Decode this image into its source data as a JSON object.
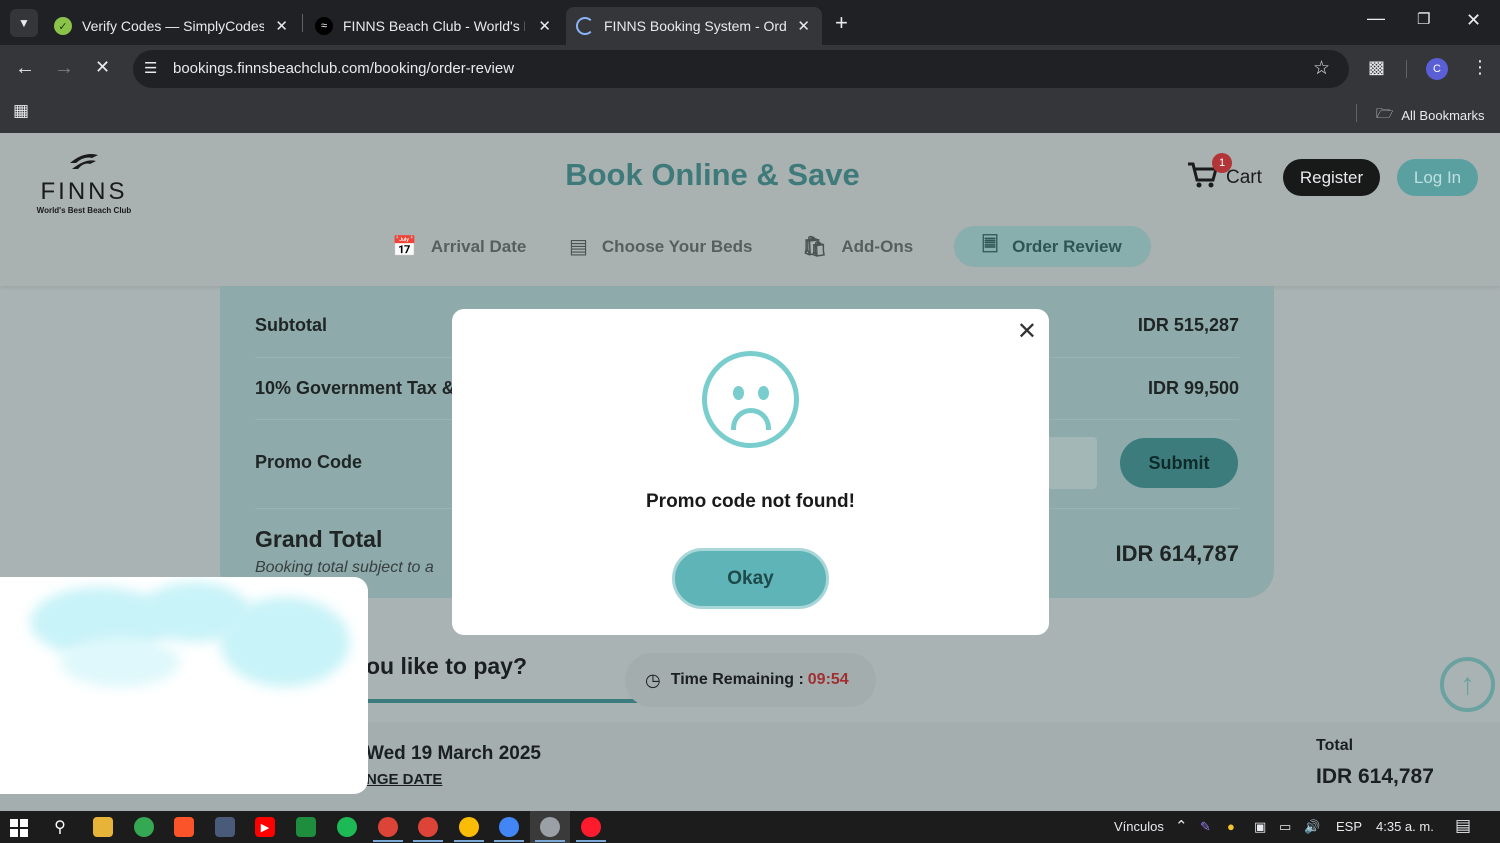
{
  "browser": {
    "tabs": [
      {
        "title": "Verify Codes — SimplyCodes",
        "active": false
      },
      {
        "title": "FINNS Beach Club - World's Best",
        "active": false
      },
      {
        "title": "FINNS Booking System - Order",
        "active": true
      }
    ],
    "url": "bookings.finnsbeachclub.com/booking/order-review",
    "profile_initial": "C",
    "bookmarks_label": "All Bookmarks"
  },
  "site": {
    "logo_word": "FINNS",
    "logo_tagline": "World's Best Beach Club",
    "headline": "Book Online & Save",
    "cart_label": "Cart",
    "cart_count": "1",
    "register_label": "Register",
    "login_label": "Log In",
    "steps": [
      {
        "label": "Arrival Date",
        "icon": "calendar-icon"
      },
      {
        "label": "Choose Your Beds",
        "icon": "bed-icon"
      },
      {
        "label": "Add-Ons",
        "icon": "bag-icon"
      },
      {
        "label": "Order Review",
        "icon": "document-icon",
        "active": true
      }
    ]
  },
  "summary": {
    "subtotal_label": "Subtotal",
    "subtotal_value": "IDR 515,287",
    "tax_label": "10% Government Tax &",
    "tax_value": "IDR 99,500",
    "promo_label": "Promo Code",
    "submit_label": "Submit",
    "grand_total_label": "Grand Total",
    "grand_total_note": "Booking total subject to a",
    "grand_total_value": "IDR 614,787"
  },
  "payment": {
    "question_fragment": "ou like to pay?",
    "timer_label": "Time Remaining :",
    "timer_value": "09:54",
    "date_fragment": "Wed 19 March 2025",
    "change_date_fragment": "NGE DATE",
    "total_label": "Total",
    "total_value": "IDR 614,787"
  },
  "modal": {
    "message": "Promo code not found!",
    "okay_label": "Okay",
    "icon": "sad-face-icon",
    "accent_color": "#79cdcd"
  },
  "taskbar": {
    "links_label": "Vínculos",
    "language": "ESP",
    "time": "4:35 a. m."
  }
}
